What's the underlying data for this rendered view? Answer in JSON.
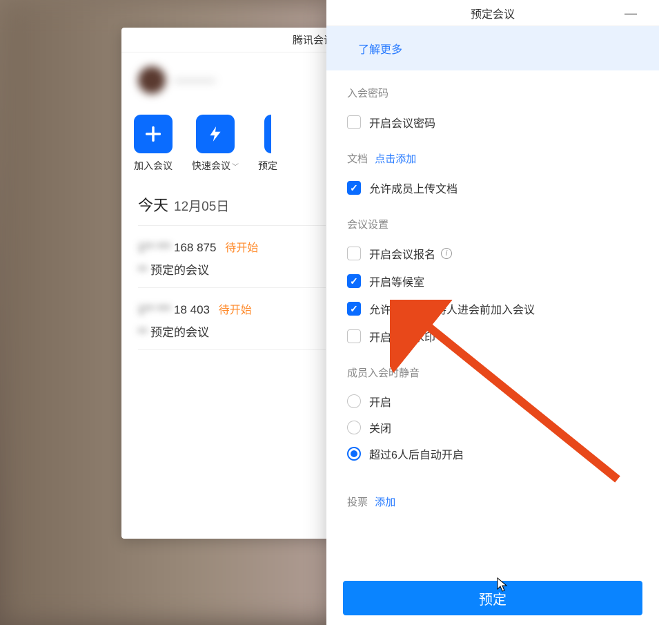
{
  "mainWindow": {
    "title": "腾讯会议",
    "user": {
      "name": "————"
    },
    "actions": {
      "join": "加入会议",
      "quick": "快速会议",
      "schedule": "预定"
    },
    "today": {
      "label": "今天",
      "date": "12月05日"
    },
    "meetings": [
      {
        "idPartial": "168 875",
        "status": "待开始",
        "title": "预定的会议"
      },
      {
        "idPartial": "18 403",
        "status": "待开始",
        "title": "预定的会议"
      }
    ]
  },
  "scheduleDialog": {
    "title": "预定会议",
    "learnMore": "了解更多",
    "password": {
      "sectionTitle": "入会密码",
      "enableLabel": "开启会议密码",
      "enabled": false
    },
    "document": {
      "sectionTitle": "文档",
      "addLink": "点击添加",
      "allowUploadLabel": "允许成员上传文档",
      "allowUpload": true
    },
    "settings": {
      "sectionTitle": "会议设置",
      "enableEnrollLabel": "开启会议报名",
      "enableEnroll": false,
      "enableWaitingLabel": "开启等候室",
      "enableWaiting": true,
      "allowBeforeHostLabel": "允许成员在主持人进会前加入会议",
      "allowBeforeHost": true,
      "enableWatermarkLabel": "开启会议水印",
      "enableWatermark": false
    },
    "muteOnEntry": {
      "sectionTitle": "成员入会时静音",
      "options": {
        "on": "开启",
        "off": "关闭",
        "auto": "超过6人后自动开启"
      },
      "selected": "auto"
    },
    "vote": {
      "sectionTitle": "投票",
      "addLink": "添加"
    },
    "submitLabel": "预定"
  }
}
